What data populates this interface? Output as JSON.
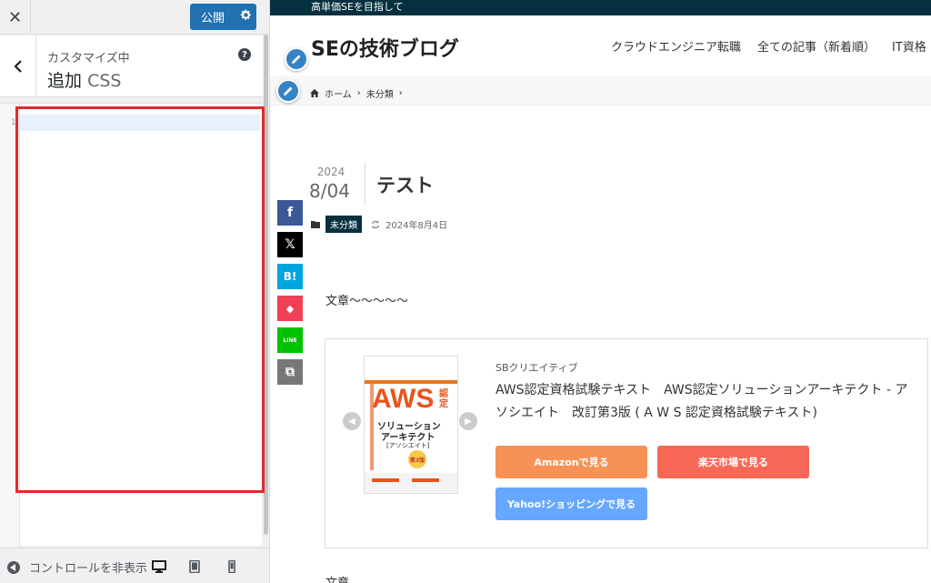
{
  "customizer": {
    "close_label": "✕",
    "publish_label": "公開",
    "header_sub": "カスタマイズ中",
    "header_title_main": "追加",
    "header_title_css": "CSS",
    "help_label": "?",
    "editor_line_number": "1",
    "collapse_label": "コントロールを非表示",
    "accent_color": "#2271b1",
    "highlight_color": "#e12b2b"
  },
  "preview": {
    "topbar_text": "高単価SEを目指して",
    "site_title": "SEの技術ブログ",
    "nav": [
      "クラウドエンジニア転職",
      "全ての記事（新着順）",
      "IT資格"
    ],
    "breadcrumb": {
      "home": "ホーム",
      "sep1": "›",
      "category": "未分類",
      "sep2": "›"
    },
    "post": {
      "year": "2024",
      "month_day": "8/04",
      "title": "テスト",
      "category": "未分類",
      "updated": "2024年8月4日",
      "body": "文章～～～～～"
    },
    "share": {
      "facebook": "f",
      "x": "𝕏",
      "hatena": "B!",
      "pocket": "◆",
      "line": "LINE",
      "copy": "⧉"
    },
    "product": {
      "brand": "SBクリエイティブ",
      "title": "AWS認定資格試験テキスト　AWS認定ソリューションアーキテクト - アソシエイト　改訂第3版 ( A W S 認定資格試験テキスト)",
      "book_label_aws": "AWS",
      "book_label_cert": "認定",
      "book_label_sa": "ソリューション",
      "book_label_arch": "アーキテクト",
      "book_label_assoc": "[アソシエイト]",
      "book_label_ed": "第3版",
      "amazon": "Amazonで見る",
      "rakuten": "楽天市場で見る",
      "yahoo": "Yahoo!ショッピングで見る",
      "amazon_color": "#f79256",
      "rakuten_color": "#f76956",
      "yahoo_color": "#66a7ff"
    },
    "more_text": "文章"
  }
}
